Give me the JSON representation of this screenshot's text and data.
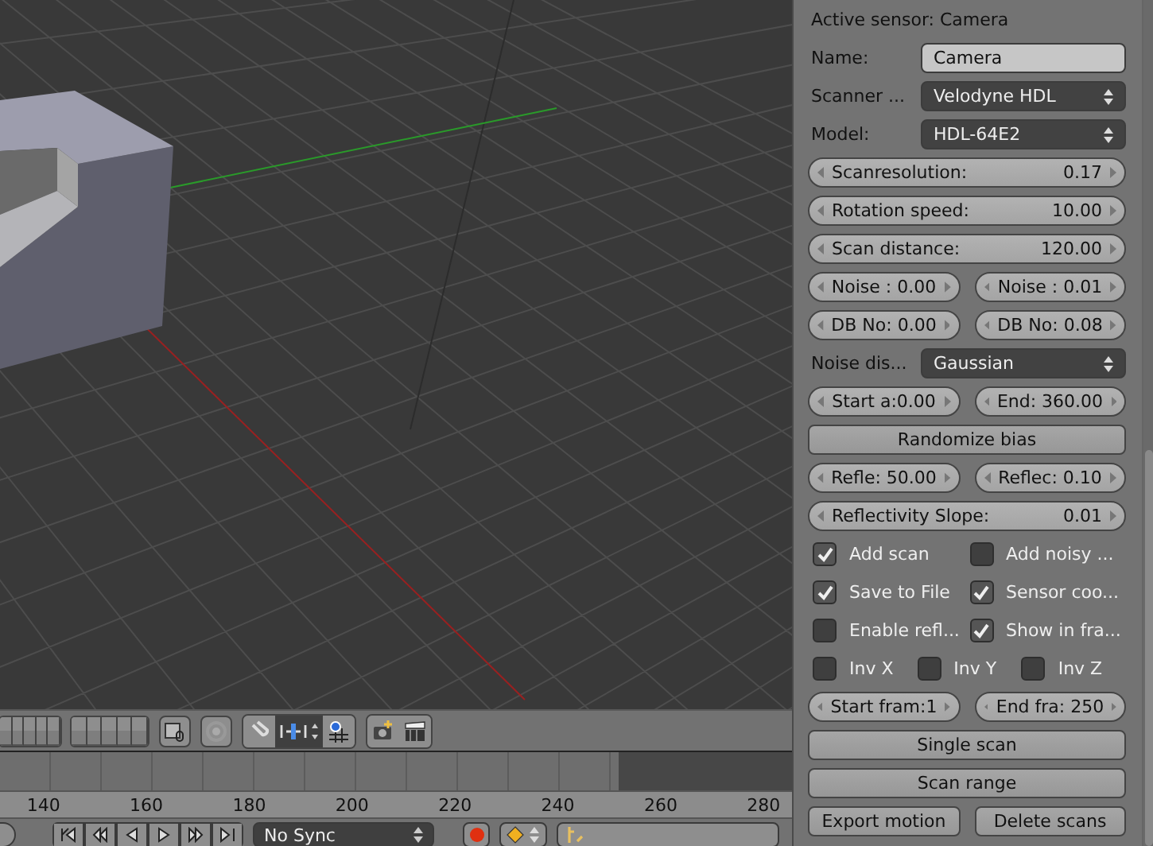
{
  "panel": {
    "rows": [
      {
        "kind": "header",
        "text": "Active sensor: Camera"
      },
      {
        "kind": "text",
        "label": "Name:",
        "value": "Camera"
      },
      {
        "kind": "select",
        "label": "Scanner ...",
        "value": "Velodyne HDL"
      },
      {
        "kind": "select",
        "label": "Model:",
        "value": "HDL-64E2"
      },
      {
        "kind": "slider",
        "label": "Scanresolution:",
        "value": "0.17"
      },
      {
        "kind": "slider",
        "label": "Rotation speed:",
        "value": "10.00"
      },
      {
        "kind": "slider",
        "label": "Scan distance:",
        "value": "120.00"
      },
      {
        "kind": "pair",
        "items": [
          {
            "text": "Noise : 0.00"
          },
          {
            "text": "Noise : 0.01"
          }
        ]
      },
      {
        "kind": "pair",
        "items": [
          {
            "text": "DB No: 0.00"
          },
          {
            "text": "DB No: 0.08"
          }
        ]
      },
      {
        "kind": "select",
        "label": "Noise dis...",
        "value": "Gaussian"
      },
      {
        "kind": "pair",
        "items": [
          {
            "text": "Start a:0.00"
          },
          {
            "text": "End: 360.00"
          }
        ]
      },
      {
        "kind": "buttons",
        "items": [
          {
            "label": "Randomize bias"
          }
        ]
      },
      {
        "kind": "pair",
        "items": [
          {
            "text": "Refle: 50.00"
          },
          {
            "text": "Reflec: 0.10"
          }
        ]
      },
      {
        "kind": "slider",
        "label": "Reflectivity Slope:",
        "value": "0.01"
      },
      {
        "kind": "checks",
        "items": [
          {
            "label": "Add scan",
            "checked": true
          },
          {
            "label": "Add noisy ...",
            "checked": false
          }
        ]
      },
      {
        "kind": "checks",
        "items": [
          {
            "label": "Save to File",
            "checked": true
          },
          {
            "label": "Sensor coo...",
            "checked": true
          }
        ]
      },
      {
        "kind": "checks",
        "items": [
          {
            "label": "Enable refl...",
            "checked": false
          },
          {
            "label": "Show in fra...",
            "checked": true
          }
        ]
      },
      {
        "kind": "checks",
        "items": [
          {
            "label": "Inv X",
            "checked": false
          },
          {
            "label": "Inv Y",
            "checked": false
          },
          {
            "label": "Inv Z",
            "checked": false
          }
        ]
      },
      {
        "kind": "pair",
        "items": [
          {
            "text": "Start fram:1"
          },
          {
            "text": "End fra: 250"
          }
        ]
      },
      {
        "kind": "buttons",
        "items": [
          {
            "label": "Single scan"
          }
        ]
      },
      {
        "kind": "buttons",
        "items": [
          {
            "label": "Scan range"
          }
        ]
      },
      {
        "kind": "buttons",
        "items": [
          {
            "label": "Export motion"
          },
          {
            "label": "Delete scans"
          }
        ]
      }
    ]
  },
  "timeline": {
    "ruler_labels": [
      "140",
      "160",
      "180",
      "200",
      "220",
      "240",
      "260",
      "280"
    ]
  },
  "playback": {
    "sync": "No Sync"
  }
}
